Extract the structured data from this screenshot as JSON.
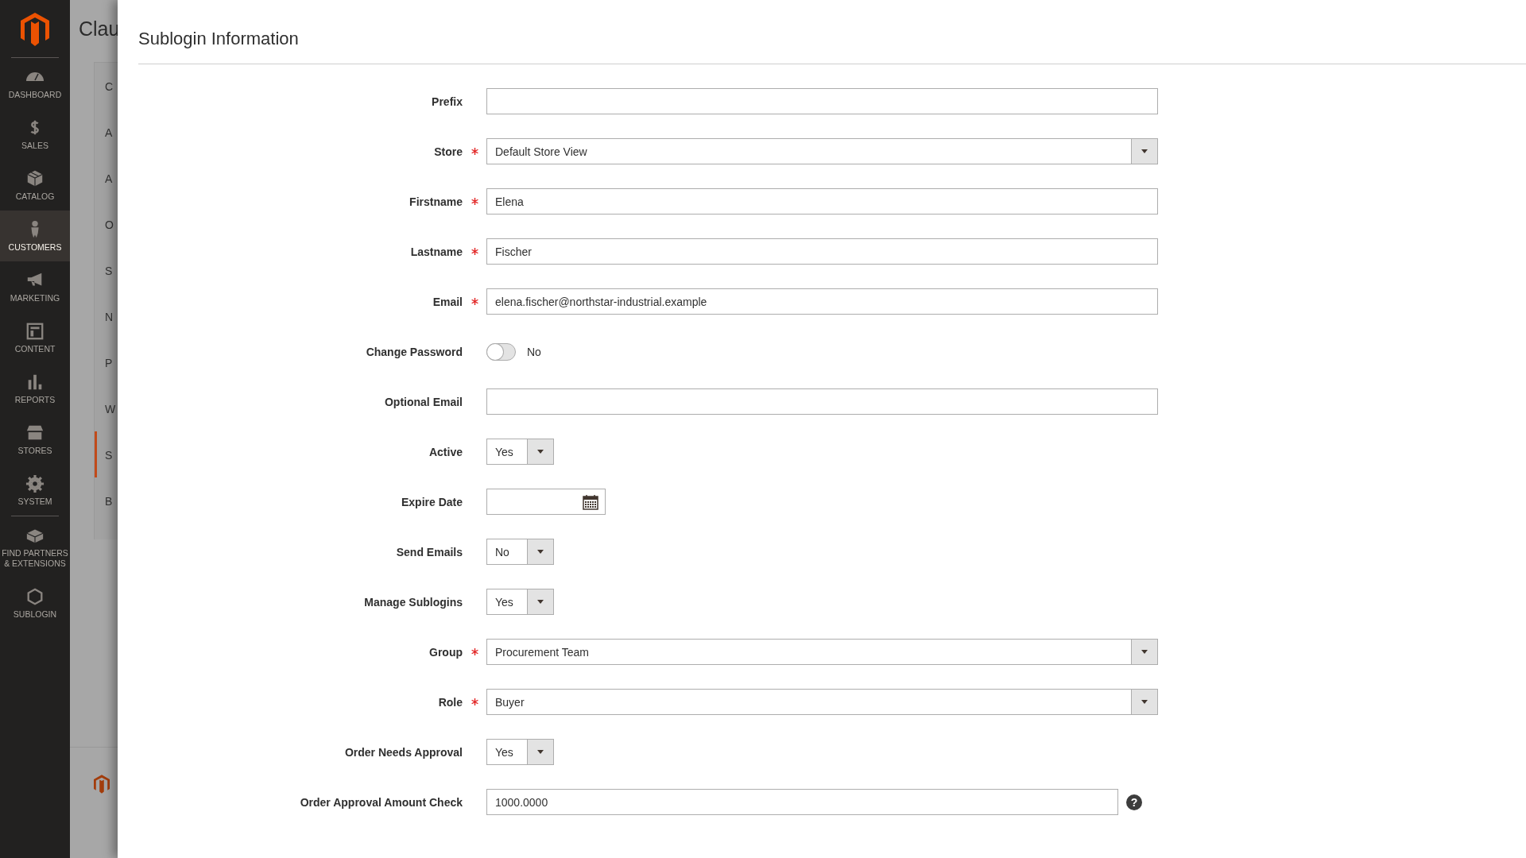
{
  "sidebar": {
    "items": [
      {
        "label": "DASHBOARD",
        "selected": false
      },
      {
        "label": "SALES",
        "selected": false
      },
      {
        "label": "CATALOG",
        "selected": false
      },
      {
        "label": "CUSTOMERS",
        "selected": true
      },
      {
        "label": "MARKETING",
        "selected": false
      },
      {
        "label": "CONTENT",
        "selected": false
      },
      {
        "label": "REPORTS",
        "selected": false
      },
      {
        "label": "STORES",
        "selected": false
      },
      {
        "label": "SYSTEM",
        "selected": false
      },
      {
        "label": "FIND PARTNERS & EXTENSIONS",
        "selected": false
      },
      {
        "label": "SUBLOGIN",
        "selected": false
      }
    ]
  },
  "background_page": {
    "title": "Clau",
    "tabs": [
      {
        "label": "C",
        "selected": false
      },
      {
        "label": "A",
        "selected": false
      },
      {
        "label": "A",
        "selected": false
      },
      {
        "label": "O",
        "selected": false
      },
      {
        "label": "S",
        "selected": false
      },
      {
        "label": "N",
        "selected": false
      },
      {
        "label": "P",
        "selected": false
      },
      {
        "label": "W",
        "selected": false
      },
      {
        "label": "S",
        "selected": true
      },
      {
        "label": "B",
        "selected": false
      }
    ]
  },
  "panel": {
    "title": "Sublogin Information",
    "fields": [
      {
        "kind": "text",
        "label": "Prefix",
        "required": false
      },
      {
        "kind": "select",
        "label": "Store",
        "required": true,
        "value": "Default Store View"
      },
      {
        "kind": "text",
        "label": "Firstname",
        "required": true,
        "value": "Elena"
      },
      {
        "kind": "text",
        "label": "Lastname",
        "required": true,
        "value": "Fischer"
      },
      {
        "kind": "text",
        "label": "Email",
        "required": true,
        "value": "elena.fischer@northstar-industrial.example"
      },
      {
        "kind": "toggle",
        "label": "Change Password",
        "required": false,
        "on": false,
        "value": "No"
      },
      {
        "kind": "text",
        "label": "Optional Email",
        "required": false
      },
      {
        "kind": "small-select",
        "label": "Active",
        "required": false,
        "value": "Yes"
      },
      {
        "kind": "date",
        "label": "Expire Date",
        "required": false
      },
      {
        "kind": "small-select",
        "label": "Send Emails",
        "required": false,
        "value": "No"
      },
      {
        "kind": "small-select",
        "label": "Manage Sublogins",
        "required": false,
        "value": "Yes"
      },
      {
        "kind": "select",
        "label": "Group",
        "required": true,
        "value": "Procurement Team"
      },
      {
        "kind": "select",
        "label": "Role",
        "required": true,
        "value": "Buyer"
      },
      {
        "kind": "small-select",
        "label": "Order Needs Approval",
        "required": false,
        "value": "Yes"
      },
      {
        "kind": "text",
        "label": "Order Approval Amount Check",
        "required": false,
        "value": "1000.0000",
        "help": "?"
      }
    ]
  }
}
